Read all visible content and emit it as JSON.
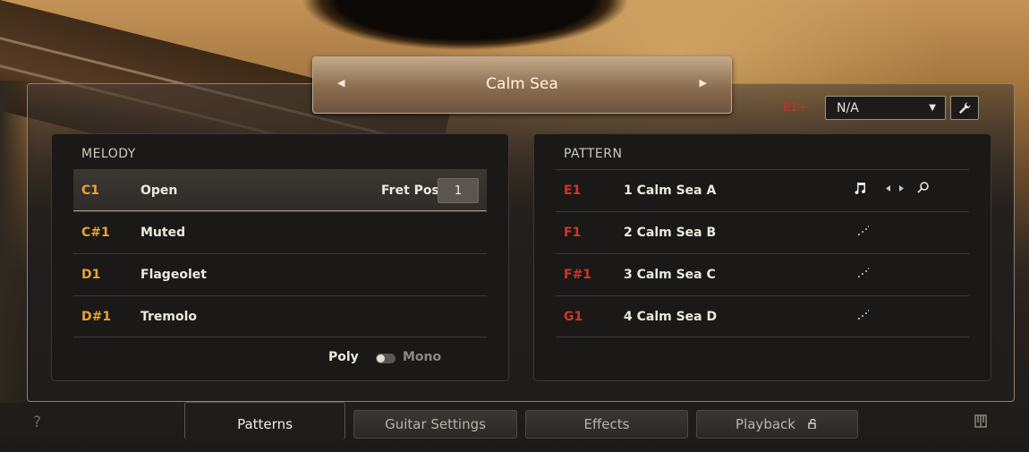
{
  "preset": {
    "name": "Calm Sea",
    "prev_arrow": "◀",
    "next_arrow": "▶"
  },
  "topbar": {
    "keyswitch_label": "E1+",
    "dropdown_value": "N/A",
    "dropdown_caret": "▼",
    "wrench_icon": "wrench-icon"
  },
  "melody": {
    "title": "MELODY",
    "rows": [
      {
        "key": "C1",
        "label": "Open"
      },
      {
        "key": "C#1",
        "label": "Muted"
      },
      {
        "key": "D1",
        "label": "Flageolet"
      },
      {
        "key": "D#1",
        "label": "Tremolo"
      }
    ],
    "fret_pos_label": "Fret Pos",
    "fret_pos_value": "1",
    "poly_label": "Poly",
    "mono_label": "Mono"
  },
  "pattern": {
    "title": "PATTERN",
    "rows": [
      {
        "key": "E1",
        "label": "1  Calm Sea A"
      },
      {
        "key": "F1",
        "label": "2  Calm Sea B"
      },
      {
        "key": "F#1",
        "label": "3  Calm Sea C"
      },
      {
        "key": "G1",
        "label": "4  Calm Sea D"
      }
    ],
    "icons": [
      "music-note-icon",
      "prev-icon",
      "next-icon",
      "search-icon"
    ]
  },
  "tabs": [
    "Patterns",
    "Guitar Settings",
    "Effects",
    "Playback"
  ],
  "help_label": "?",
  "colors": {
    "melody_key": "#e8a233",
    "pattern_key": "#d0342c",
    "keyswitch": "#c3332b"
  }
}
